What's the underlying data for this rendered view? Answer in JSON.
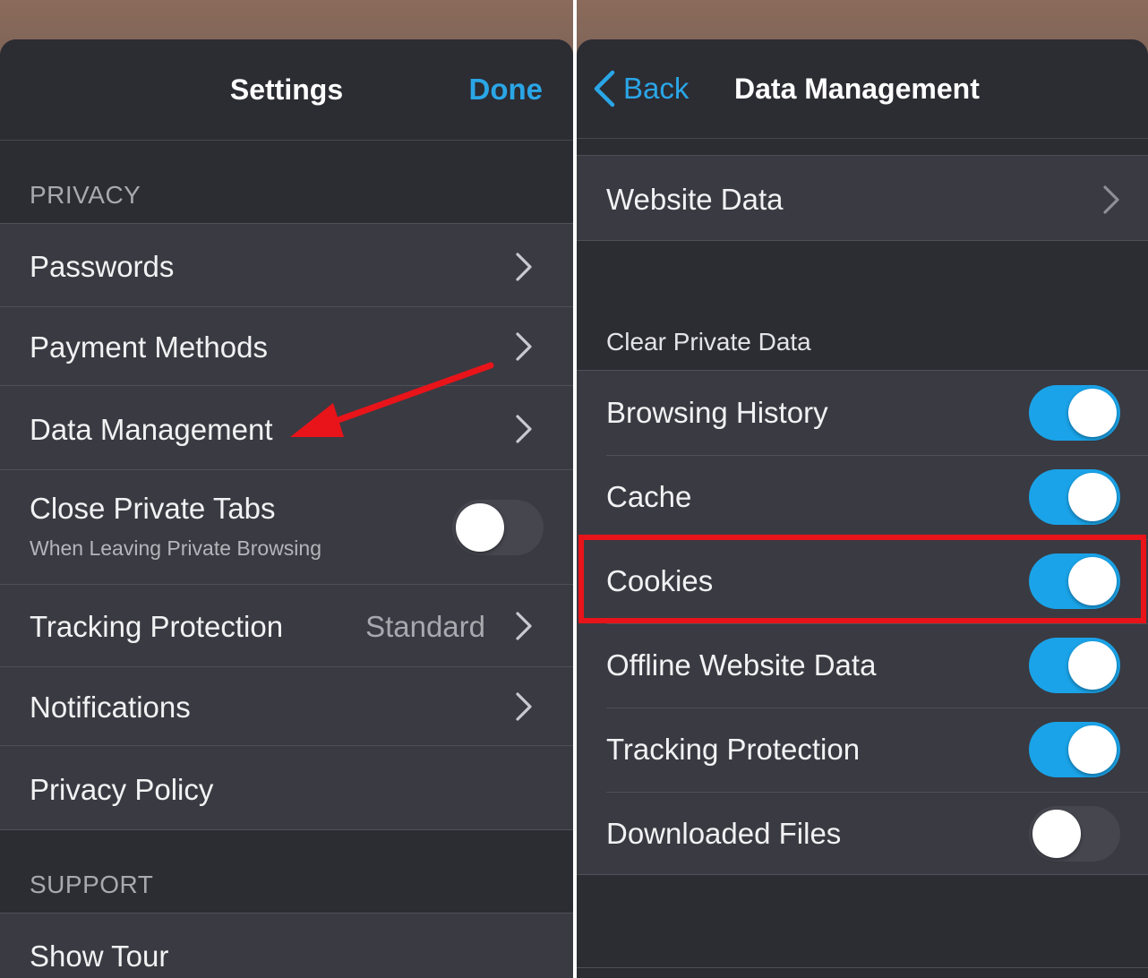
{
  "left": {
    "title": "Settings",
    "done_label": "Done",
    "privacy_header": "PRIVACY",
    "support_header": "SUPPORT",
    "rows": [
      {
        "label": "Passwords"
      },
      {
        "label": "Payment Methods"
      },
      {
        "label": "Data Management"
      },
      {
        "label": "Close Private Tabs",
        "sublabel": "When Leaving Private Browsing",
        "toggle": false
      },
      {
        "label": "Tracking Protection",
        "value": "Standard"
      },
      {
        "label": "Notifications"
      },
      {
        "label": "Privacy Policy"
      }
    ],
    "support_rows": [
      {
        "label": "Show Tour"
      }
    ]
  },
  "right": {
    "back_label": "Back",
    "title": "Data Management",
    "website_data_label": "Website Data",
    "clear_header": "Clear Private Data",
    "toggles": [
      {
        "label": "Browsing History",
        "on": true
      },
      {
        "label": "Cache",
        "on": true
      },
      {
        "label": "Cookies",
        "on": true
      },
      {
        "label": "Offline Website Data",
        "on": true
      },
      {
        "label": "Tracking Protection",
        "on": true
      },
      {
        "label": "Downloaded Files",
        "on": false
      }
    ]
  },
  "colors": {
    "accent": "#2aa6e6",
    "toggle_on": "#1aa3e8",
    "annotation_red": "#e8141a",
    "background": "#2c2c33",
    "row": "#3a3a42"
  },
  "icons": [
    "chevron-right-icon",
    "chevron-left-icon",
    "toggle-switch",
    "red-arrow-annotation"
  ]
}
